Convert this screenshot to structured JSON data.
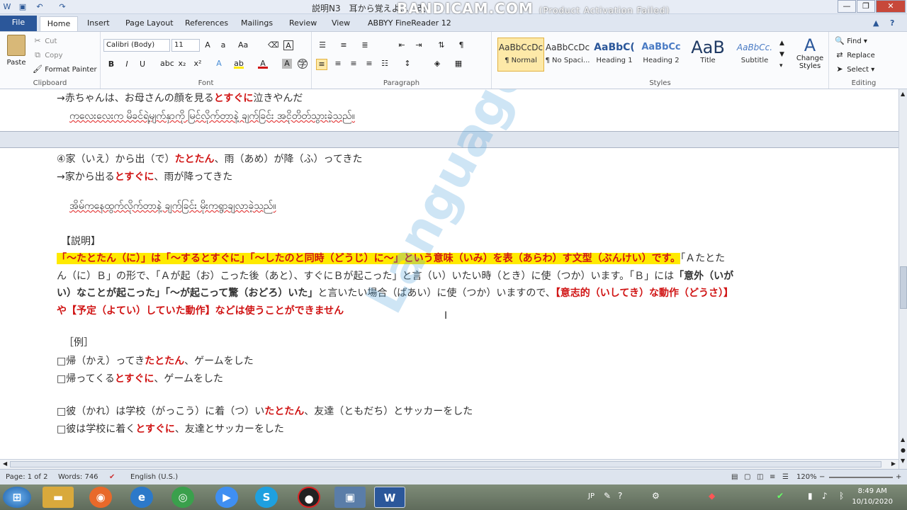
{
  "window": {
    "title": "説明N3　耳から覚えよ…　改",
    "watermark_brand": "BANDICAM.COM",
    "watermark_note": "(Product Activation Failed)"
  },
  "tabs": [
    "File",
    "Home",
    "Insert",
    "Page Layout",
    "References",
    "Mailings",
    "Review",
    "View",
    "ABBYY FineReader 12"
  ],
  "clipboard": {
    "paste": "Paste",
    "cut": "Cut",
    "copy": "Copy",
    "format_painter": "Format Painter",
    "label": "Clipboard"
  },
  "font": {
    "family": "Calibri (Body)",
    "size": "11",
    "label": "Font"
  },
  "paragraph": {
    "label": "Paragraph"
  },
  "styles": {
    "label": "Styles",
    "items": [
      {
        "preview": "AaBbCcDc",
        "name": "¶ Normal"
      },
      {
        "preview": "AaBbCcDc",
        "name": "¶ No Spaci..."
      },
      {
        "preview": "AaBbC(",
        "name": "Heading 1"
      },
      {
        "preview": "AaBbCc",
        "name": "Heading 2"
      },
      {
        "preview": "AaB",
        "name": "Title"
      },
      {
        "preview": "AaBbCc.",
        "name": "Subtitle"
      }
    ],
    "change_styles": "Change Styles"
  },
  "editing": {
    "find": "Find",
    "replace": "Replace",
    "select": "Select",
    "label": "Editing"
  },
  "doc": {
    "l1": "→赤ちゃんは、お母さんの顔を見るとすぐに泣きやんだ",
    "l2": "ကလေးလေးက မိခင်ရဲ့မျက်နှာကို မြင်လိုက်တာနဲ့ ချက်ခြင်း အငိုတိတ်သွားခဲ့သည်။",
    "l3a": "④家（いえ）から出（で）",
    "l3b": "たとたん",
    "l3c": "、雨（あめ）が降（ふ）ってきた",
    "l4a": "→家から出る",
    "l4b": "とすぐに",
    "l4c": "、雨が降ってきた",
    "l5": "အိမ်ကနေထွက်လိုက်တာနဲ့ ချက်ခြင်း မိုးကရွာချလာခဲ့သည်။",
    "l6": "【説明】",
    "p1a": "「～たとたん（に）」は「～するとすぐに」「～したのと同時（どうじ）に～」という意味（いみ）を表（あらわ）す文型（ぶんけい）です。",
    "p1b": "「Ａたとた",
    "p2": "ん（に）Ｂ」の形で、「Ａが起（お）こった後（あと）、すぐにＢが起こった」と言（い）いたい時（とき）に使（つか）います。「Ｂ」には",
    "p2b": "「意外（いが",
    "p3a": "い）なことが起こった」「～が起こって驚（おどろ）いた」",
    "p3b": "と言いたい場合（ばあい）に使（つか）いますので、",
    "p3c": "【意志的（いしてき）な動作（どうさ）】",
    "p4": "や【予定（よてい）していた動作】などは使うことができません",
    "l7": "［例］",
    "e1a": "□帰（かえ）ってき",
    "e1b": "たとたん",
    "e1c": "、ゲームをした",
    "e2a": "□帰ってくる",
    "e2b": "とすぐに",
    "e2c": "、ゲームをした",
    "e3a": "□彼（かれ）は学校（がっこう）に着（つ）い",
    "e3b": "たとたん",
    "e3c": "、友達（ともだち）とサッカーをした",
    "e4a": "□彼は学校に着く",
    "e4b": "とすぐに",
    "e4c": "、友達とサッカーをした",
    "watermark": "Language Centre"
  },
  "status": {
    "page": "Page: 1 of 2",
    "words": "Words: 746",
    "lang": "English (U.S.)",
    "zoom": "120%"
  },
  "taskbar": {
    "ime": "JP",
    "time": "8:49 AM",
    "date": "10/10/2020"
  }
}
